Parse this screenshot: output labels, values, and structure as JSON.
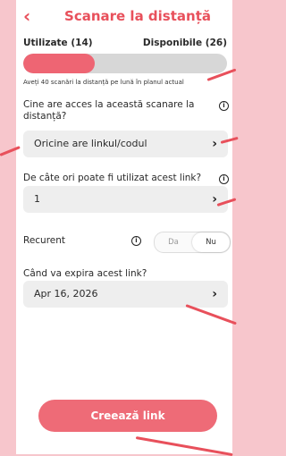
{
  "header": {
    "title": "Scanare la distanță",
    "back_icon": "chevron-left-icon"
  },
  "usage": {
    "used_label": "Utilizate (14)",
    "available_label": "Disponibile (26)",
    "used_fraction": 0.35
  },
  "plan_note": "Aveți 40 scanări la distanță pe lună în planul actual",
  "access": {
    "label": "Cine are acces la această scanare la distanță?",
    "value": "Oricine are linkul/codul"
  },
  "uses": {
    "label": "De câte ori poate fi utilizat acest link?",
    "value": "1"
  },
  "recurring": {
    "label": "Recurent",
    "yes": "Da",
    "no": "Nu",
    "selected": "Nu"
  },
  "expiry": {
    "label": "Când va expira acest link?",
    "value": "Apr 16, 2026"
  },
  "create_button": "Creează link",
  "colors": {
    "accent": "#e8505b",
    "background": "#f7c6cc",
    "progress": "#ee6573"
  }
}
